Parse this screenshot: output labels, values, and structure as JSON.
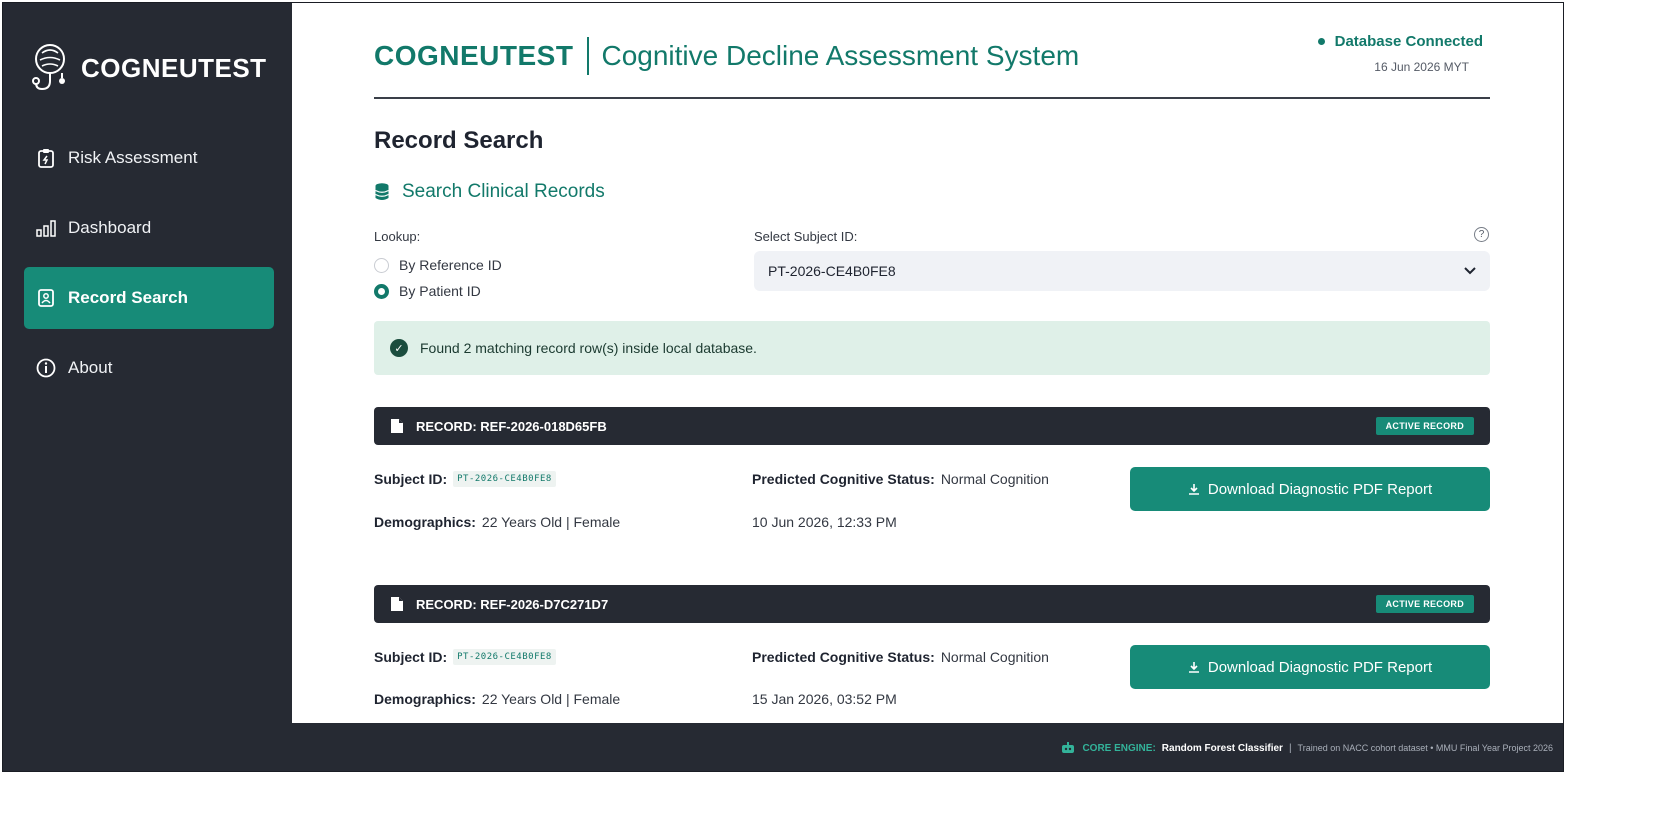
{
  "sidebar": {
    "logo_text": "COGNEUTEST",
    "items": [
      {
        "label": "Risk Assessment",
        "icon": "clipboard-icon",
        "active": false
      },
      {
        "label": "Dashboard",
        "icon": "bar-chart-icon",
        "active": false
      },
      {
        "label": "Record Search",
        "icon": "id-card-icon",
        "active": true
      },
      {
        "label": "About",
        "icon": "info-icon",
        "active": false
      }
    ]
  },
  "header": {
    "brand_name": "COGNEUTEST",
    "brand_subtitle": "Cognitive Decline Assessment System",
    "db_status": "Database Connected",
    "db_date": "16 Jun 2026 MYT"
  },
  "page": {
    "title": "Record Search",
    "section_title": "Search Clinical Records",
    "lookup_label": "Lookup:",
    "lookup_options": [
      {
        "label": "By Reference ID",
        "selected": false
      },
      {
        "label": "By Patient ID",
        "selected": true
      }
    ],
    "subject_label": "Select Subject ID:",
    "subject_value": "PT-2026-CE4B0FE8",
    "help_icon": "?",
    "alert_text": "Found 2 matching record row(s) inside local database."
  },
  "records": [
    {
      "ref": "RECORD: REF-2026-018D65FB",
      "badge": "ACTIVE RECORD",
      "subject_label": "Subject ID:",
      "subject_id": "PT-2026-CE4B0FE8",
      "status_label": "Predicted Cognitive Status:",
      "status_value": "Normal Cognition",
      "demo_label": "Demographics:",
      "demo_value": "22 Years Old | Female",
      "timestamp": "10 Jun 2026, 12:33 PM",
      "button": "Download Diagnostic PDF Report"
    },
    {
      "ref": "RECORD: REF-2026-D7C271D7",
      "badge": "ACTIVE RECORD",
      "subject_label": "Subject ID:",
      "subject_id": "PT-2026-CE4B0FE8",
      "status_label": "Predicted Cognitive Status:",
      "status_value": "Normal Cognition",
      "demo_label": "Demographics:",
      "demo_value": "22 Years Old | Female",
      "timestamp": "15 Jan 2026, 03:52 PM",
      "button": "Download Diagnostic PDF Report"
    }
  ],
  "footer": {
    "label": "CORE ENGINE:",
    "engine": "Random Forest Classifier",
    "separator": "|",
    "note": "Trained on NACC cohort dataset • MMU Final Year Project 2026"
  },
  "colors": {
    "accent": "#178b78",
    "sidebar_bg": "#262a33",
    "alert_bg": "#dff0e8"
  }
}
